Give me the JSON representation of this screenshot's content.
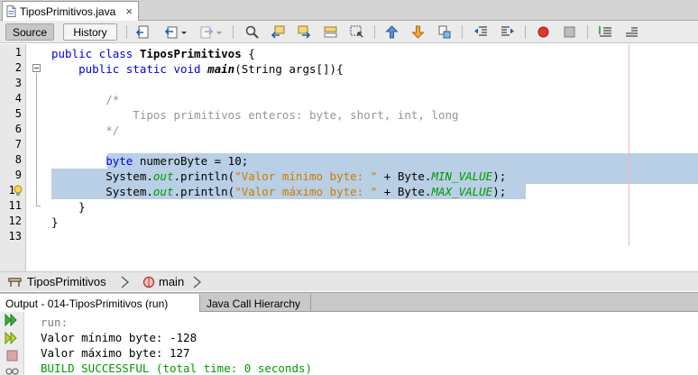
{
  "file_tab": {
    "title": "TiposPrimitivos.java",
    "close": "×"
  },
  "toolbar": {
    "source_label": "Source",
    "history_label": "History"
  },
  "editor": {
    "line_numbers": [
      "1",
      "2",
      "3",
      "4",
      "5",
      "6",
      "7",
      "8",
      "9",
      "10",
      "11",
      "12",
      "13"
    ],
    "lines": [
      [
        {
          "t": "public class ",
          "c": "kw"
        },
        {
          "t": "TiposPrimitivos",
          "c": "cls"
        },
        {
          "t": " {",
          "c": ""
        }
      ],
      [
        {
          "t": "    public static void ",
          "c": "kw"
        },
        {
          "t": "main",
          "c": "mth"
        },
        {
          "t": "(String args[]){",
          "c": ""
        }
      ],
      [],
      [
        {
          "t": "        /*",
          "c": "cm"
        }
      ],
      [
        {
          "t": "            Tipos primitivos enteros: byte, short, int, long",
          "c": "cm"
        }
      ],
      [
        {
          "t": "        */",
          "c": "cm"
        }
      ],
      [],
      [
        {
          "t": "        ",
          "c": ""
        },
        {
          "t": "byte",
          "c": "kw"
        },
        {
          "t": " numeroByte = 10;",
          "c": ""
        }
      ],
      [
        {
          "t": "        System.",
          "c": ""
        },
        {
          "t": "out",
          "c": "fld"
        },
        {
          "t": ".println(",
          "c": ""
        },
        {
          "t": "\"Valor mínimo byte: \"",
          "c": "str"
        },
        {
          "t": " + Byte.",
          "c": ""
        },
        {
          "t": "MIN_VALUE",
          "c": "fld"
        },
        {
          "t": ");",
          "c": ""
        }
      ],
      [
        {
          "t": "        System.",
          "c": ""
        },
        {
          "t": "out",
          "c": "fld"
        },
        {
          "t": ".println(",
          "c": ""
        },
        {
          "t": "\"Valor máximo byte: \"",
          "c": "str"
        },
        {
          "t": " + Byte.",
          "c": ""
        },
        {
          "t": "MAX_VALUE",
          "c": "fld"
        },
        {
          "t": ");",
          "c": ""
        }
      ],
      [
        {
          "t": "    }",
          "c": ""
        }
      ],
      [
        {
          "t": "}",
          "c": ""
        }
      ],
      []
    ]
  },
  "breadcrumb": {
    "class_name": "TiposPrimitivos",
    "method_name": "main"
  },
  "output_tabs": [
    {
      "label": "Output - 014-TiposPrimitivos (run)"
    },
    {
      "label": "Java Call Hierarchy"
    }
  ],
  "output": {
    "lines": [
      {
        "text": "run:",
        "color": "#808080"
      },
      {
        "text": "Valor mínimo byte: -128",
        "color": "#000000"
      },
      {
        "text": "Valor máximo byte: 127",
        "color": "#000000"
      },
      {
        "text": "BUILD SUCCESSFUL (total time: 0 seconds)",
        "color": "#009900"
      }
    ]
  },
  "colors": {
    "selection": "#b8cfe5",
    "keyword": "#0000e6",
    "string": "#ce7b00",
    "field": "#009900",
    "comment": "#969696"
  }
}
